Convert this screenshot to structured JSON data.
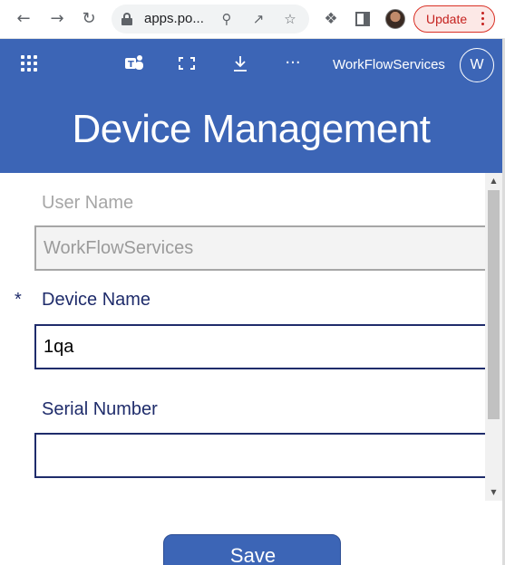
{
  "browser": {
    "back_icon": "arrow-left-icon",
    "forward_icon": "arrow-right-icon",
    "reload_icon": "reload-icon",
    "url": "apps.po...",
    "update_label": "Update"
  },
  "app_header": {
    "user_name": "WorkFlowServices",
    "avatar_initial": "W"
  },
  "page": {
    "title": "Device Management"
  },
  "form": {
    "user_name": {
      "label": "User Name",
      "value": "WorkFlowServices"
    },
    "device_name": {
      "required_marker": "*",
      "label": "Device Name",
      "value": "1qa"
    },
    "serial_number": {
      "label": "Serial Number",
      "value": ""
    },
    "save_label": "Save"
  },
  "colors": {
    "header_blue": "#3c65b6",
    "label_navy": "#1f2c6b",
    "update_red": "#c5221f"
  }
}
